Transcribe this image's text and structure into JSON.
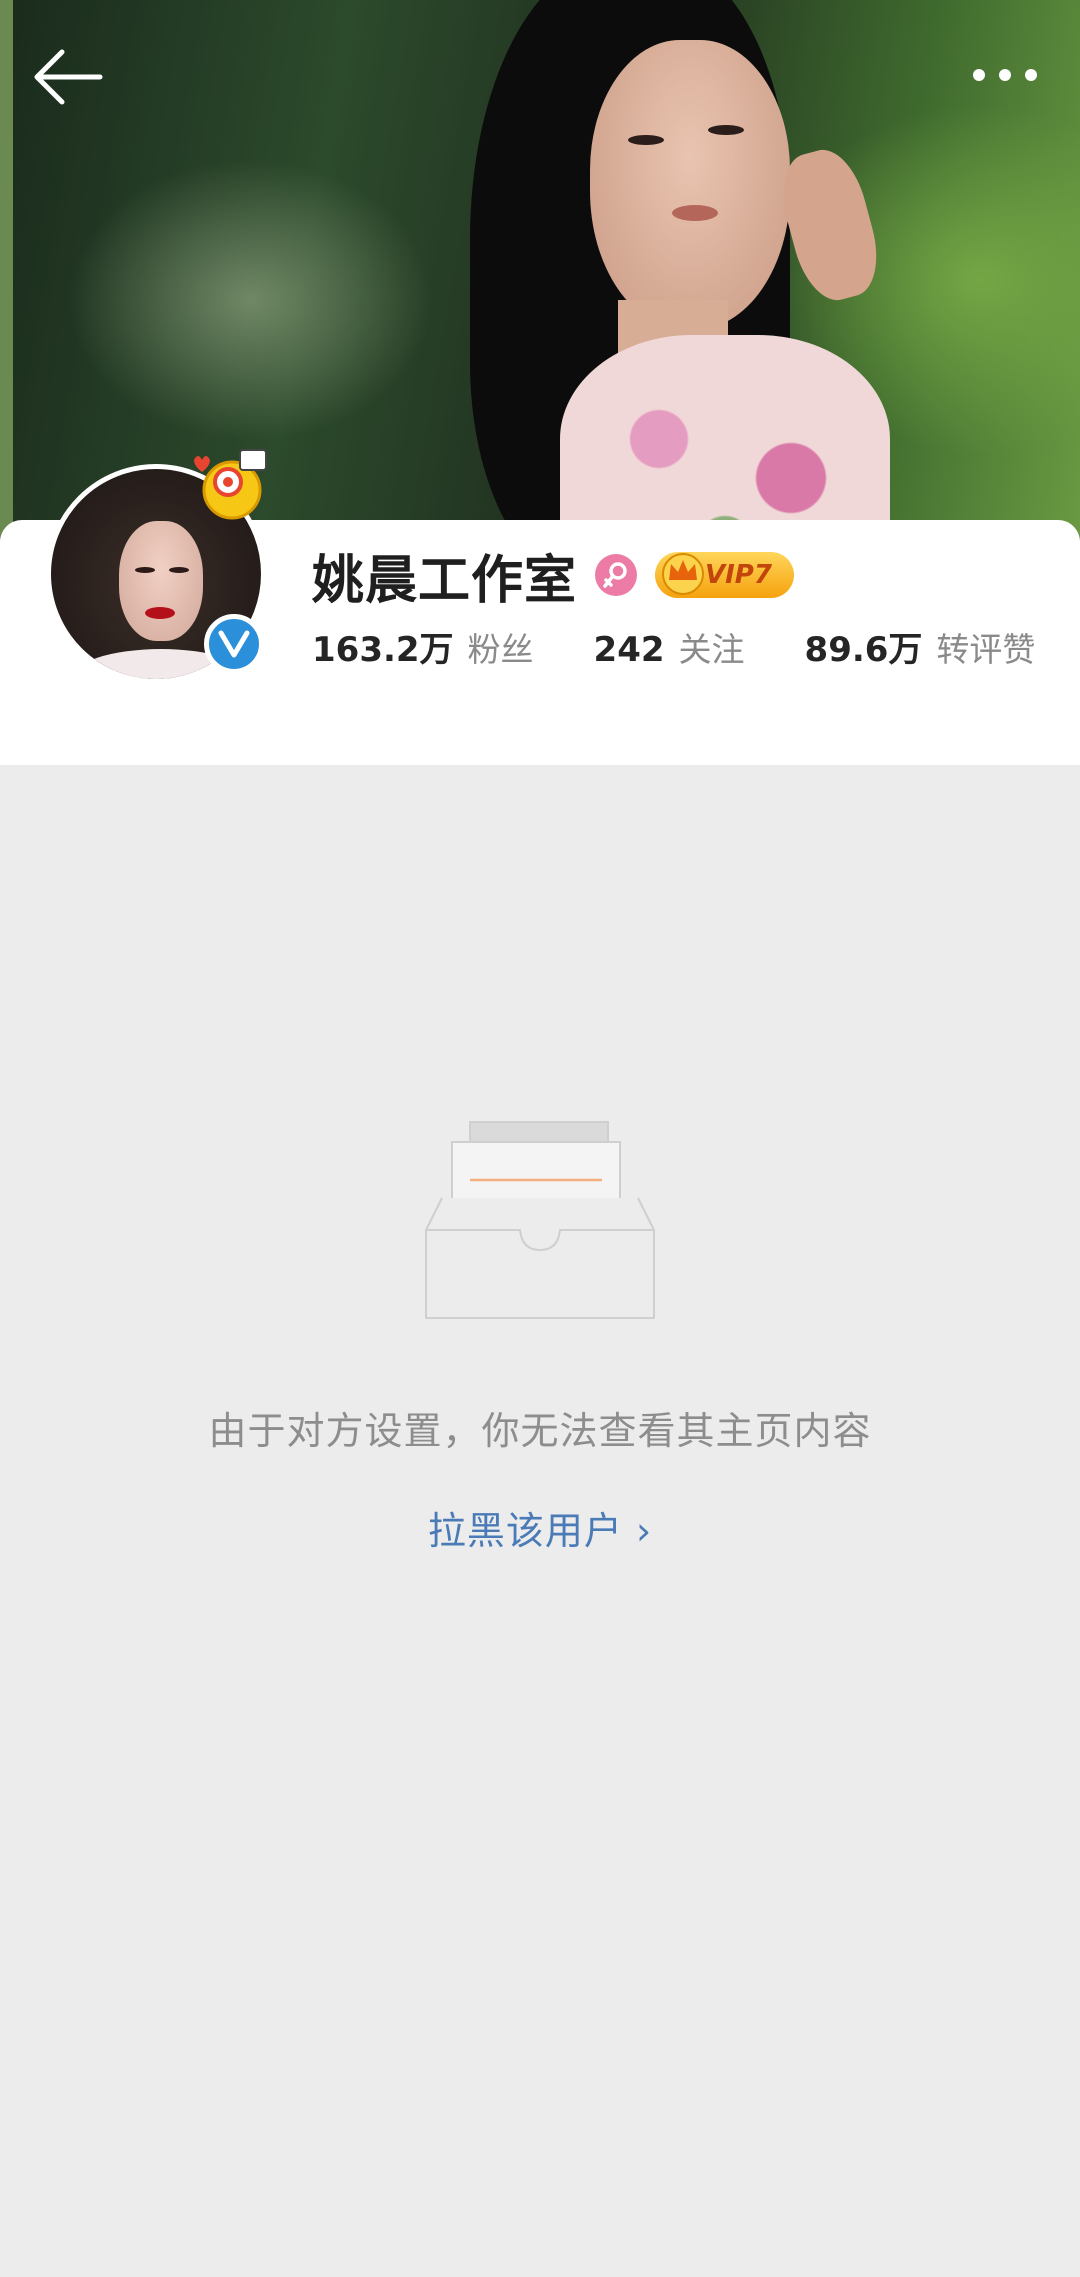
{
  "header": {
    "back_icon": "arrow-left-icon",
    "more_icon": "more-horizontal-icon"
  },
  "profile": {
    "name": "姚晨工作室",
    "gender_icon": "female-icon",
    "vip_label": "VIP7",
    "verified_icon": "verified-v-icon",
    "stats": [
      {
        "value": "163.2万",
        "label": "粉丝"
      },
      {
        "value": "242",
        "label": "关注"
      },
      {
        "value": "89.6万",
        "label": "转评赞"
      }
    ]
  },
  "empty_state": {
    "icon": "empty-inbox-icon",
    "message": "由于对方设置，你无法查看其主页内容",
    "link_label": "拉黑该用户 ›"
  },
  "colors": {
    "background": "#ececec",
    "link": "#4a7bb7",
    "verified": "#2b8fd9",
    "gender": "#ec7ba6",
    "vip": "#f5a20e"
  }
}
